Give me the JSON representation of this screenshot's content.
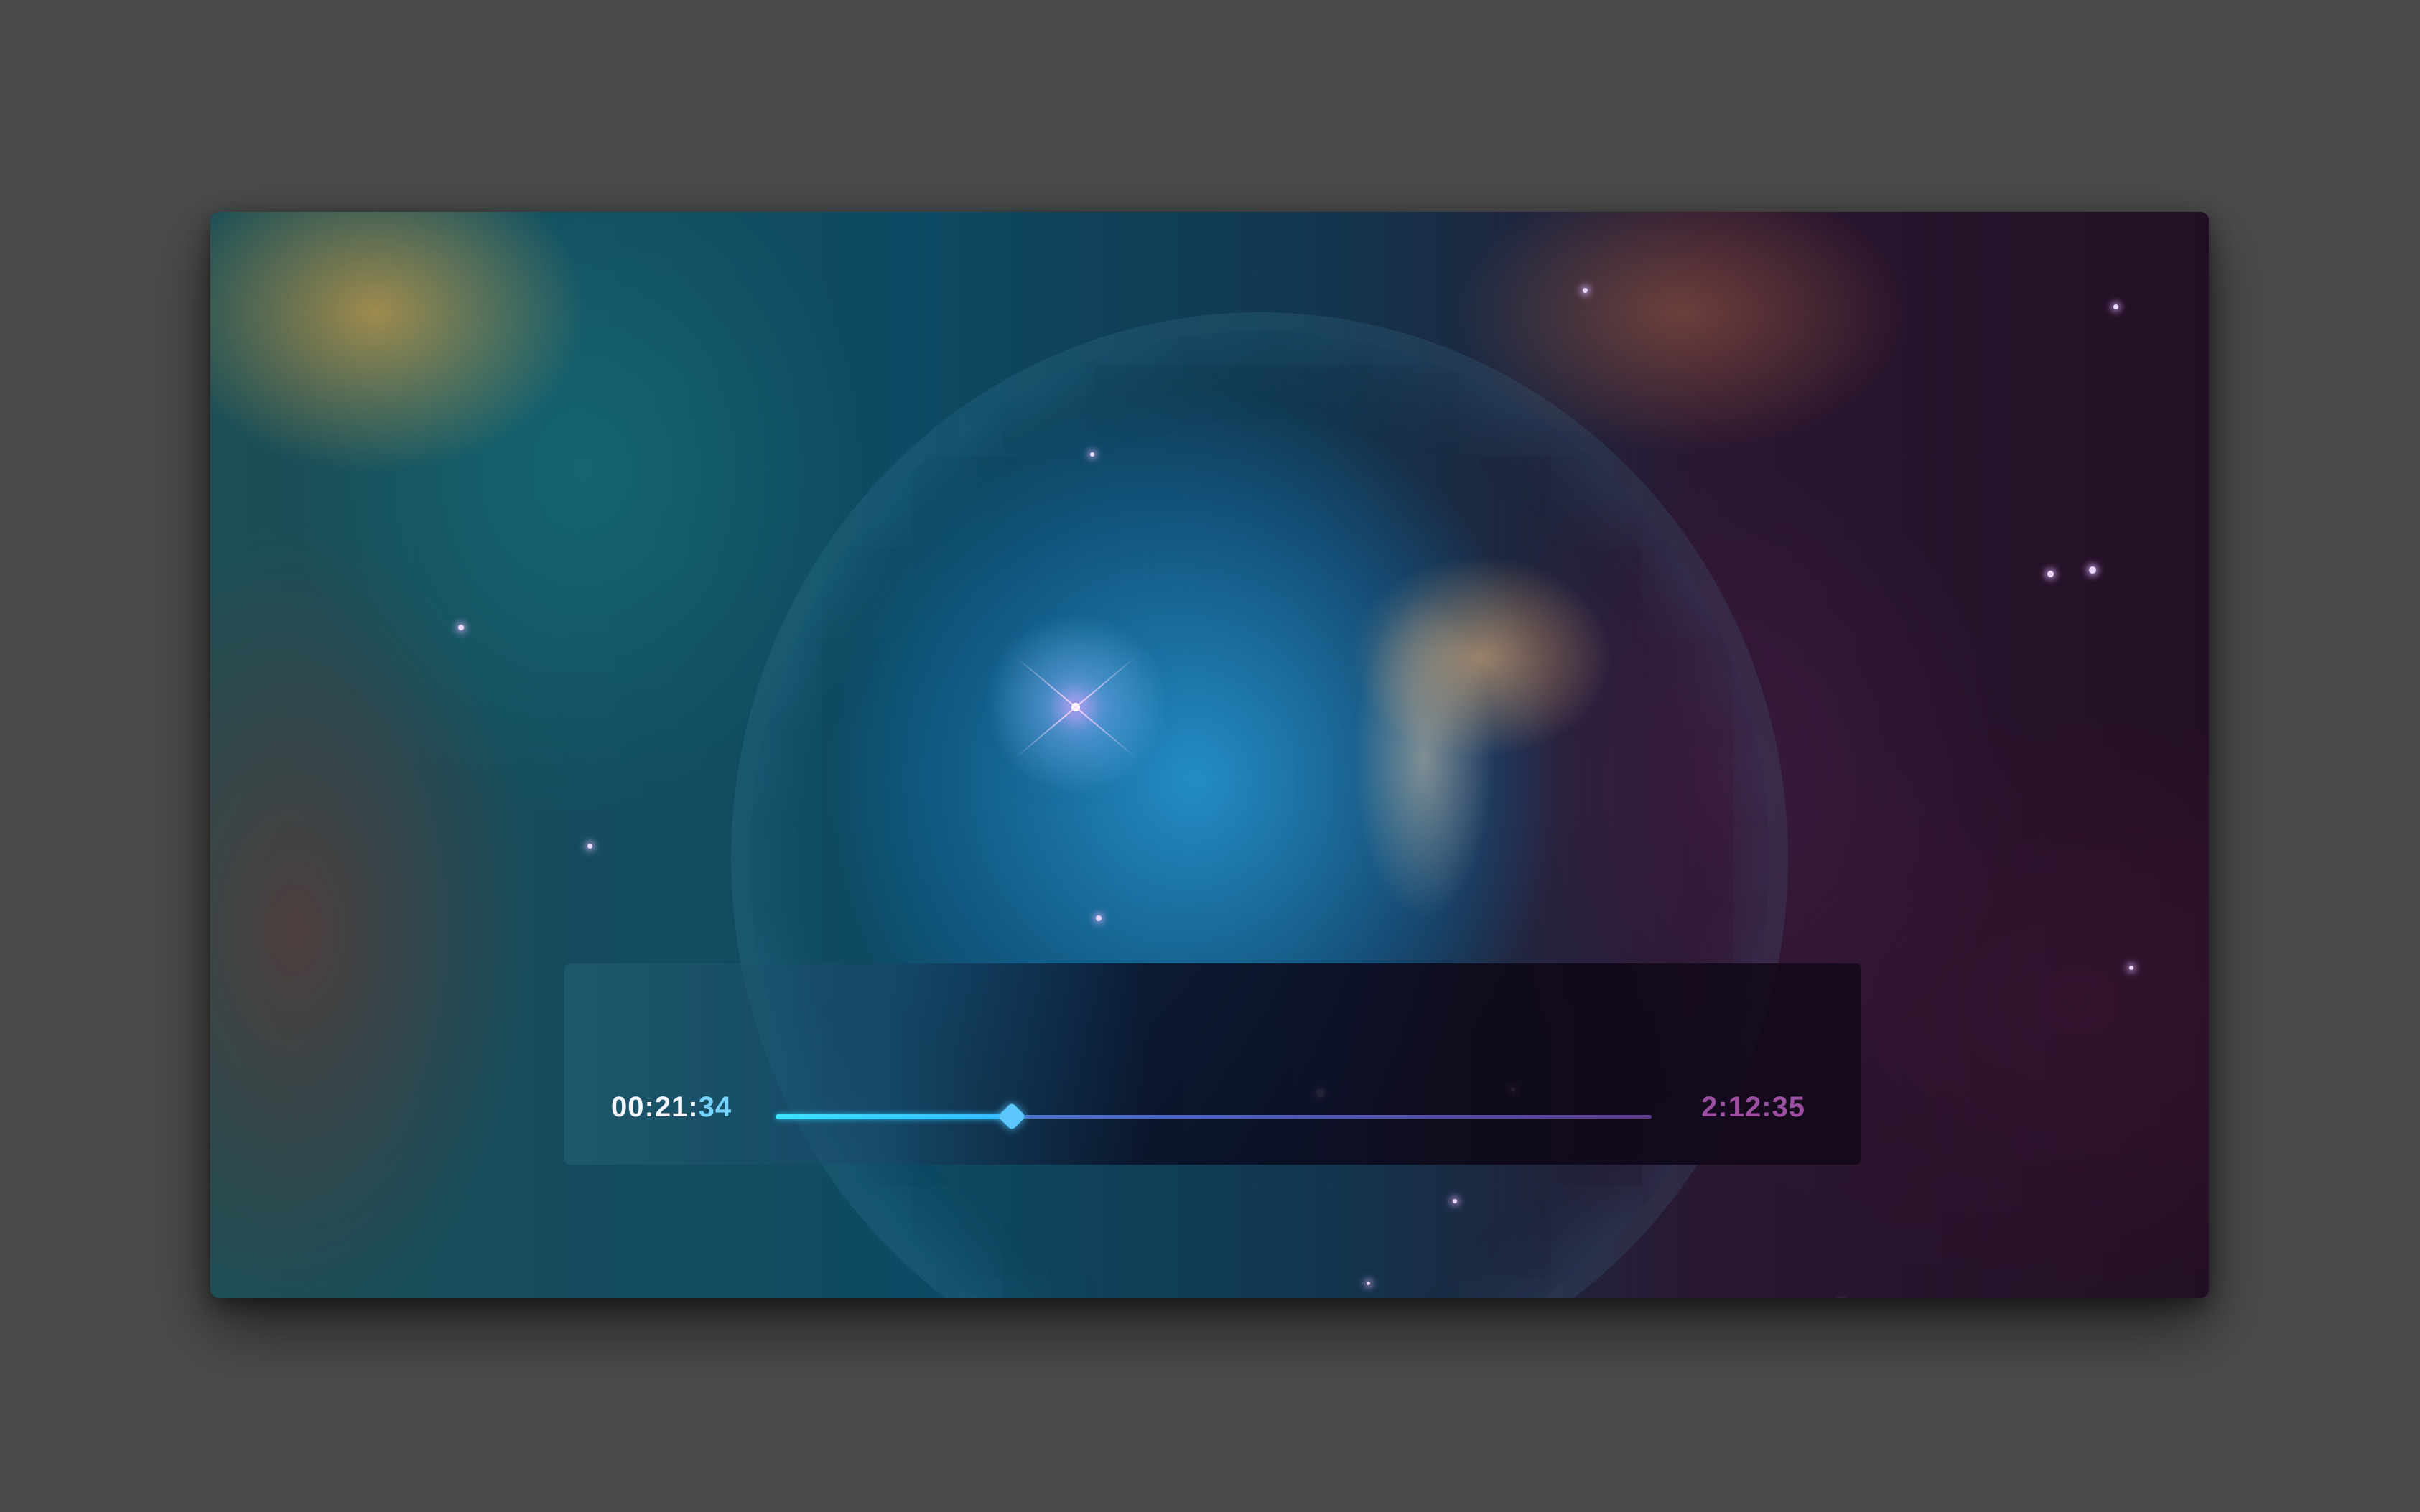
{
  "player": {
    "current_time_main": "00:21:",
    "current_time_accent": "34",
    "total_time": "2:12:35",
    "progress": 0.27
  },
  "colors": {
    "page_background": "#4b4b4b",
    "progress_fill": "#3fe0ff",
    "thumb": "#5cc7ff",
    "current_time_accent": "#74d4ff",
    "total_time": "#9c4ea0"
  },
  "icons": {
    "scrubber_thumb": "diamond-thumb-icon"
  }
}
